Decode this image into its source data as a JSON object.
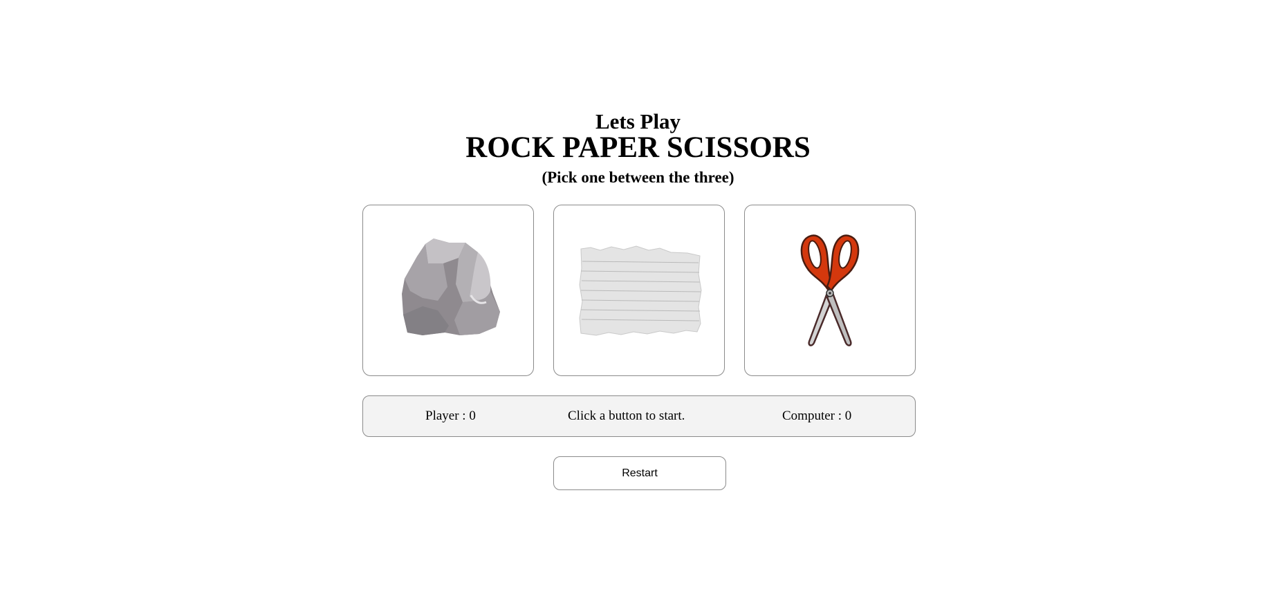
{
  "header": {
    "intro": "Lets Play",
    "title": "ROCK PAPER SCISSORS",
    "instruction": "(Pick one between the three)"
  },
  "choices": [
    {
      "name": "rock",
      "icon": "rock-icon"
    },
    {
      "name": "paper",
      "icon": "paper-icon"
    },
    {
      "name": "scissors",
      "icon": "scissors-icon"
    }
  ],
  "scoreboard": {
    "player": "Player : 0",
    "status": "Click a button to start.",
    "computer": "Computer : 0"
  },
  "restart_label": "Restart",
  "colors": {
    "border": "#8a8a8a",
    "scoreboard_bg": "#f3f3f3",
    "scissors_handle": "#d4380d"
  }
}
